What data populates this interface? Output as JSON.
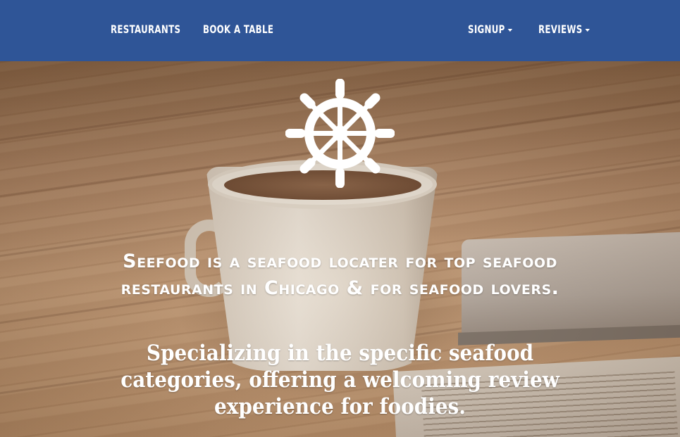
{
  "nav": {
    "restaurants": "RESTAURANTS",
    "book_a_table": "BOOK A TABLE",
    "signup": "SIGNUP",
    "reviews": "REVIEWS"
  },
  "hero": {
    "logo_icon": "ship-wheel-icon",
    "headline": "Seefood is a seafood locater for top seafood restaurants in Chicago & for seafood lovers.",
    "subline": "Specializing in the specific seafood categories, offering a welcoming review experience for foodies."
  },
  "colors": {
    "navbar": "#2f5597",
    "text": "#ffffff"
  }
}
